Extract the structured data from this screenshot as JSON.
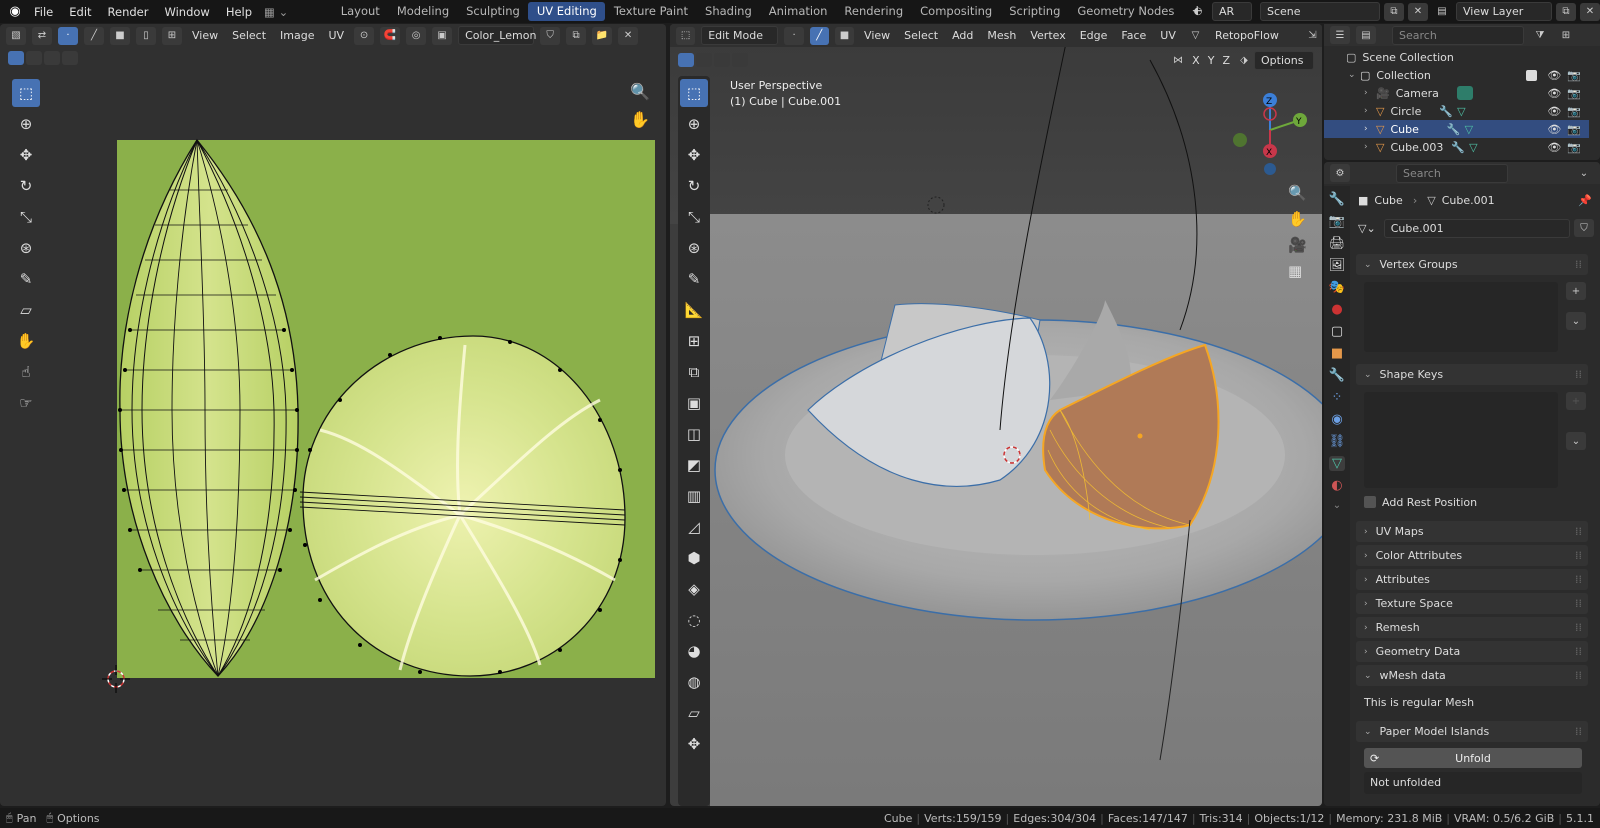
{
  "menu": [
    "File",
    "Edit",
    "Render",
    "Window",
    "Help"
  ],
  "workspaces": [
    "Layout",
    "Modeling",
    "Sculpting",
    "UV Editing",
    "Texture Paint",
    "Shading",
    "Animation",
    "Rendering",
    "Compositing",
    "Scripting",
    "Geometry Nodes"
  ],
  "active_workspace": "UV Editing",
  "topright": {
    "lang": "AR",
    "scene": "Scene",
    "view_layer": "View Layer"
  },
  "uv_header": {
    "view": "View",
    "select": "Select",
    "image": "Image",
    "uv": "UV",
    "image_name": "Color_Lemon"
  },
  "vp_header": {
    "mode": "Edit Mode",
    "view": "View",
    "select": "Select",
    "add": "Add",
    "mesh": "Mesh",
    "vertex": "Vertex",
    "edge": "Edge",
    "face": "Face",
    "uv": "UV",
    "addon": "RetopoFlow",
    "options": "Options"
  },
  "axis_labels": [
    "X",
    "Y",
    "Z"
  ],
  "viewport_info": {
    "line1": "User Perspective",
    "line2": "(1) Cube | Cube.001"
  },
  "outliner": {
    "search_placeholder": "Search",
    "items": [
      {
        "label": "Scene Collection"
      },
      {
        "label": "Collection"
      },
      {
        "label": "Camera"
      },
      {
        "label": "Circle"
      },
      {
        "label": "Cube"
      },
      {
        "label": "Cube.003"
      }
    ]
  },
  "properties": {
    "search_placeholder": "Search",
    "breadcrumb_object": "Cube",
    "breadcrumb_mesh": "Cube.001",
    "mesh_name": "Cube.001",
    "sections": [
      "Vertex Groups",
      "Shape Keys",
      "UV Maps",
      "Color Attributes",
      "Attributes",
      "Texture Space",
      "Remesh",
      "Geometry Data",
      "wMesh data",
      "Paper Model Islands"
    ],
    "add_rest_position": "Add Rest Position",
    "wmesh_text": "This is regular Mesh",
    "unfold_label": "Unfold",
    "not_unfolded": "Not unfolded"
  },
  "statusbar": {
    "pan": "Pan",
    "options": "Options",
    "object": "Cube",
    "verts": "Verts:159/159",
    "edges": "Edges:304/304",
    "faces": "Faces:147/147",
    "tris": "Tris:314",
    "objects": "Objects:1/12",
    "memory": "Memory: 231.8 MiB",
    "vram": "VRAM: 0.5/6.2 GiB",
    "version": "5.1.1"
  },
  "colors": {
    "accent": "#4772b3",
    "selected_row": "#334d80",
    "texture_green": "#8bb04a",
    "object_orange": "#f5a623"
  }
}
